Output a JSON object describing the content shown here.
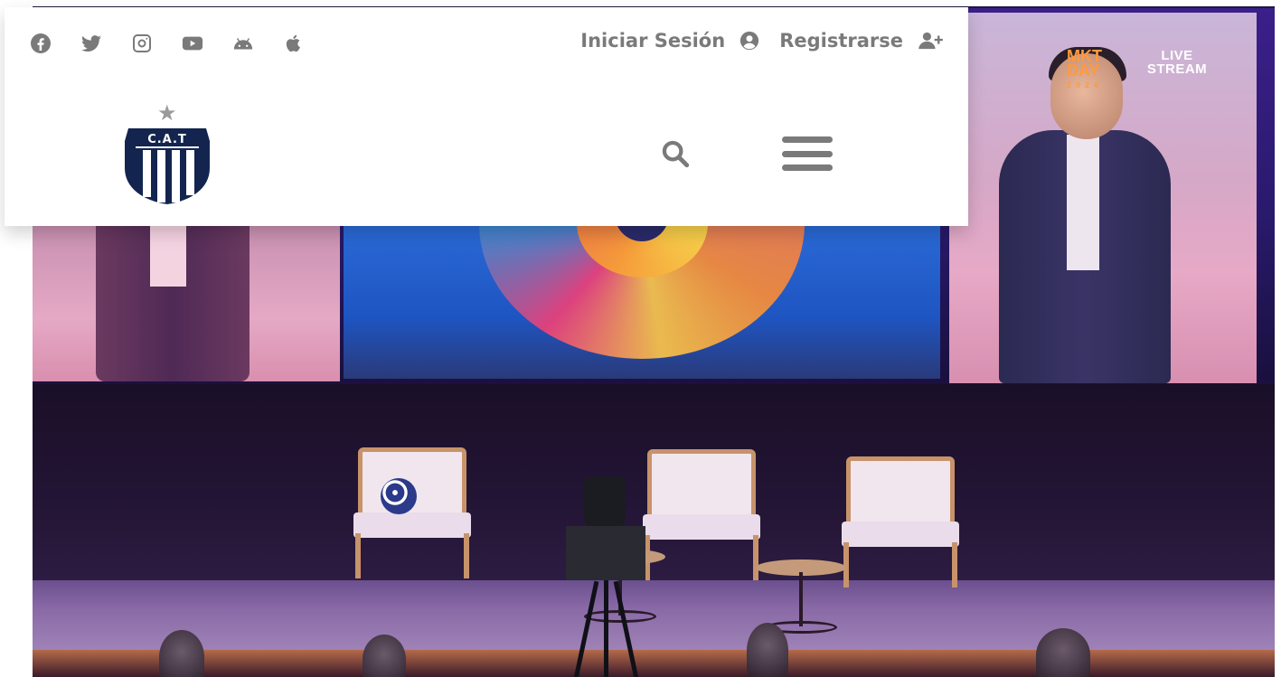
{
  "header": {
    "social_icons": [
      "facebook-icon",
      "twitter-icon",
      "instagram-icon",
      "youtube-icon",
      "android-icon",
      "apple-icon"
    ],
    "login_label": "Iniciar Sesión",
    "register_label": "Registrarse",
    "logo_text": "C.A.T",
    "icon_color": "#7a7a7a",
    "brand_color": "#13254f"
  },
  "hero": {
    "badge_mkt": "MKT DAY",
    "badge_year": "2024",
    "badge_live": "LIVE STREAM"
  }
}
